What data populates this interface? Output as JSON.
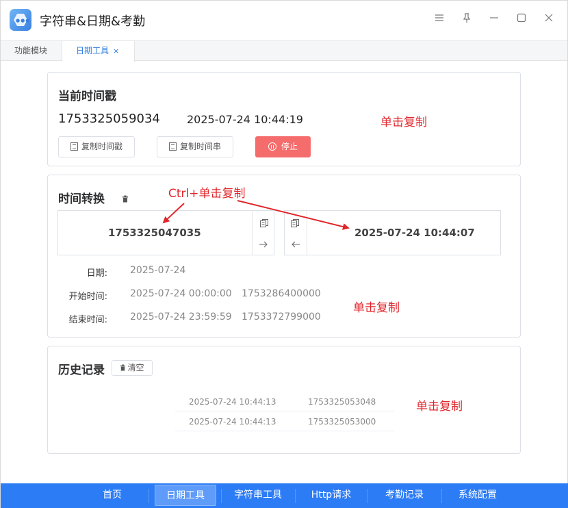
{
  "window": {
    "title": "字符串&日期&考勤",
    "controls": [
      "menu-icon",
      "pin-icon",
      "minimize-icon",
      "maximize-icon",
      "close-icon"
    ]
  },
  "tabs": [
    {
      "label": "功能模块",
      "active": false
    },
    {
      "label": "日期工具",
      "active": true,
      "close": "×"
    }
  ],
  "current": {
    "title": "当前时间戳",
    "timestamp": "1753325059034",
    "datetime": "2025-07-24 10:44:19",
    "copy_timestamp_label": "复制时间戳",
    "copy_string_label": "复制时间串",
    "stop_label": "停止",
    "note": "单击复制"
  },
  "convert": {
    "title": "时间转换",
    "note_ctrl": "Ctrl+单击复制",
    "left_value": "1753325047035",
    "right_value": "2025-07-24 10:44:07",
    "date_label": "日期:",
    "date_value": "2025-07-24",
    "start_label": "开始时间:",
    "start_datetime": "2025-07-24 00:00:00",
    "start_timestamp": "1753286400000",
    "end_label": "结束时间:",
    "end_datetime": "2025-07-24 23:59:59",
    "end_timestamp": "1753372799000",
    "note": "单击复制"
  },
  "history": {
    "title": "历史记录",
    "clear_label": "清空",
    "rows": [
      {
        "datetime": "2025-07-24 10:44:13",
        "timestamp": "1753325053048"
      },
      {
        "datetime": "2025-07-24 10:44:13",
        "timestamp": "1753325053000"
      }
    ],
    "note": "单击复制"
  },
  "nav": [
    {
      "label": "首页",
      "active": false
    },
    {
      "label": "日期工具",
      "active": true
    },
    {
      "label": "字符串工具",
      "active": false
    },
    {
      "label": "Http请求",
      "active": false
    },
    {
      "label": "考勤记录",
      "active": false
    },
    {
      "label": "系统配置",
      "active": false
    }
  ],
  "colors": {
    "accent": "#2c7cf6",
    "stop_button": "#f56c6c",
    "annotation": "#e0262b"
  }
}
